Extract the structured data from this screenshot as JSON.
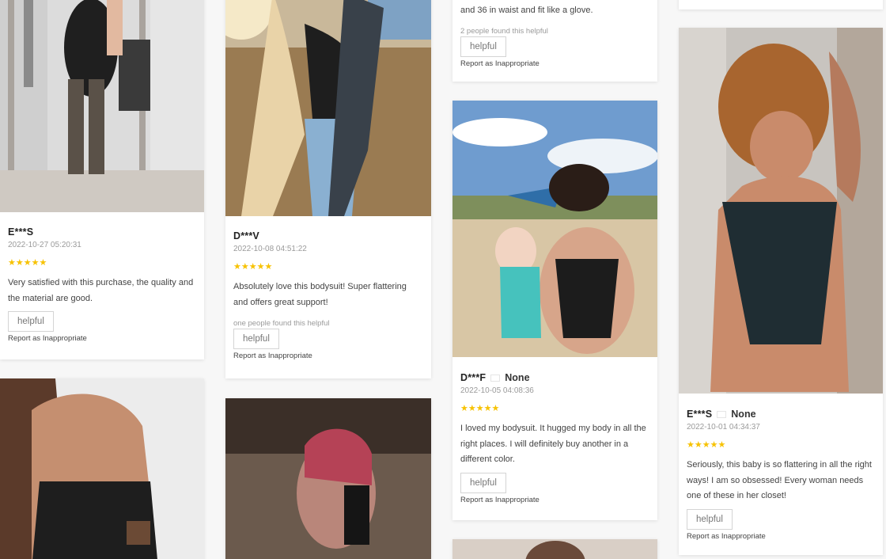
{
  "stars_symbol": "★★★★★",
  "reviews": [
    {
      "name": "E***S",
      "date": "2022-10-27 05:20:31",
      "text": "Very satisfied with this purchase, the quality and the material are good.",
      "helpful_label": "helpful",
      "report_label": "Report as Inappropriate",
      "rating": 5
    },
    {
      "name": "D***V",
      "date": "2022-10-08 04:51:22",
      "text": "Absolutely love this bodysuit! Super flattering and offers great support!",
      "found_helpful": "one people found this helpful",
      "helpful_label": "helpful",
      "report_label": "Report as Inappropriate",
      "rating": 5
    },
    {
      "text_tail": "and 36 in waist and fit like a glove.",
      "found_helpful": "2 people found this helpful",
      "helpful_label": "helpful",
      "report_label": "Report as Inappropriate"
    },
    {
      "name": "D***F",
      "country": "None",
      "date": "2022-10-05 04:08:36",
      "text": "I loved my bodysuit. It hugged my body in all the right places. I will definitely buy another in a different color.",
      "helpful_label": "helpful",
      "report_label": "Report as Inappropriate",
      "rating": 5
    },
    {
      "name": "E***S",
      "country": "None",
      "date": "2022-10-01 04:34:37",
      "text": "Seriously, this baby is so flattering in all the right ways! I am so obsessed! Every woman needs one of these in her closet!",
      "helpful_label": "helpful",
      "report_label": "Report as Inappropriate",
      "rating": 5
    }
  ],
  "colors": {
    "star": "#f7c200",
    "card_bg": "#ffffff",
    "page_bg": "#f7f7f7"
  }
}
